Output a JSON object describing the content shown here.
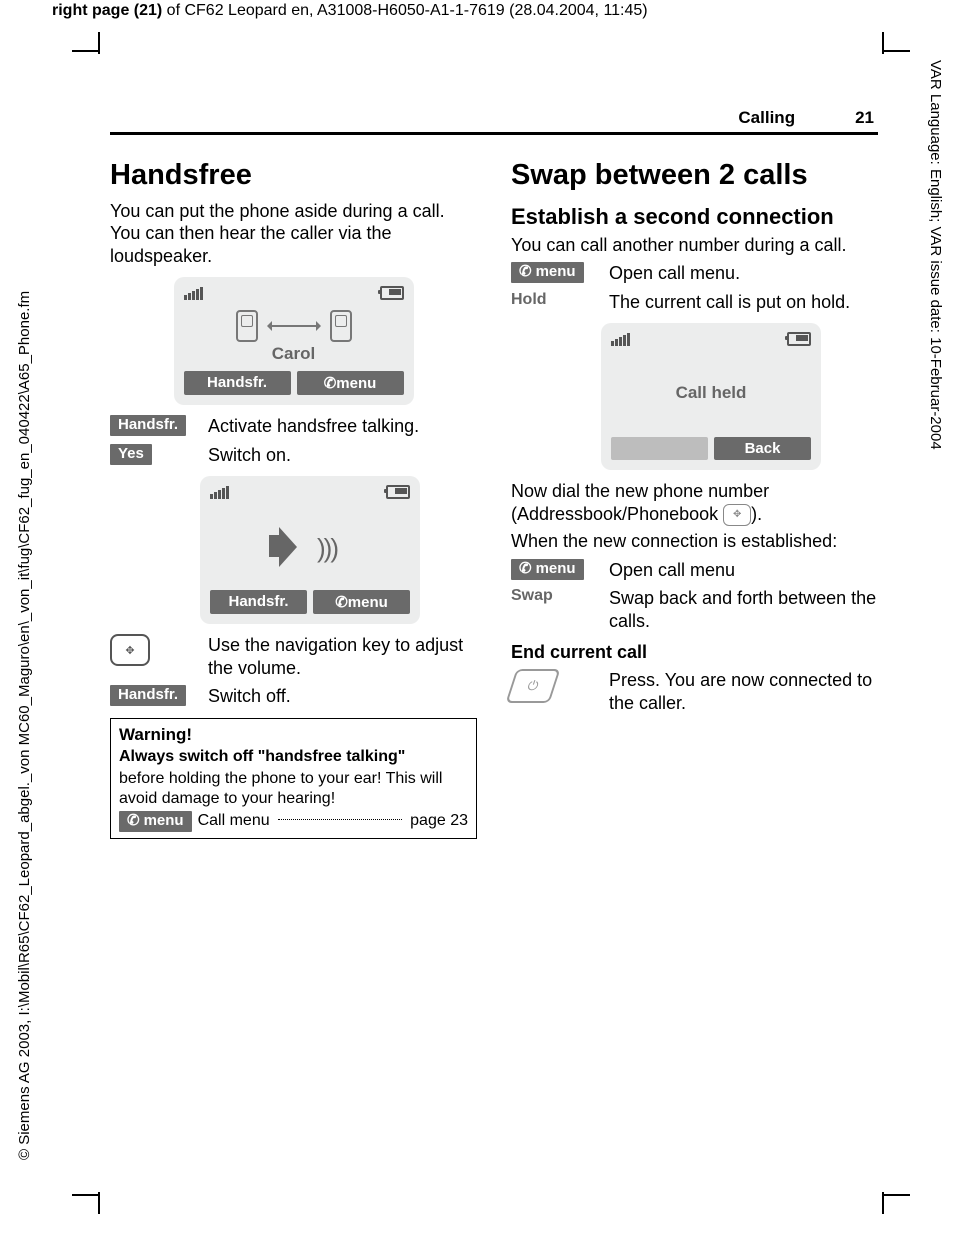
{
  "meta": {
    "top": {
      "prefix": "right page (21)",
      "rest": " of CF62 Leopard en, A31008-H6050-A1-1-7619 (28.04.2004, 11:45)"
    },
    "left": "© Siemens AG 2003, I:\\Mobil\\R65\\CF62_Leopard_abgel._von MC60_Maguro\\en\\_von_it\\fug\\CF62_fug_en_040422\\A65_Phone.fm",
    "right": "VAR Language: English; VAR issue date: 10-Februar-2004"
  },
  "runner": {
    "section": "Calling",
    "page": "21"
  },
  "left": {
    "h1": "Handsfree",
    "intro": "You can put the phone aside during a call. You can then hear the caller via the loudspeaker.",
    "screen1": {
      "caller": "Carol",
      "sk_left": "Handsfr.",
      "sk_right": "menu"
    },
    "r1": {
      "key": "Handsfr.",
      "desc": "Activate handsfree talking."
    },
    "r2": {
      "key": "Yes",
      "desc": "Switch on."
    },
    "screen2": {
      "sk_left": "Handsfr.",
      "sk_right": "menu"
    },
    "r3": {
      "desc": "Use the navigation key to adjust the volume."
    },
    "r4": {
      "key": "Handsfr.",
      "desc": "Switch off."
    },
    "warn": {
      "title": "Warning!",
      "l1": "Always switch off \"handsfree talking\"",
      "l2": "before holding the phone to your ear! This will avoid damage to your hearing!",
      "menu": "menu",
      "call": "Call menu",
      "pg": "page 23"
    }
  },
  "right": {
    "h1": "Swap between 2 calls",
    "h2": "Establish a second connection",
    "intro": "You can call another number during a call.",
    "r1": {
      "key": "menu",
      "desc": "Open call menu."
    },
    "r2": {
      "key": "Hold",
      "desc": "The current call is put on hold."
    },
    "screen": {
      "text": "Call held",
      "sk_right": "Back"
    },
    "p2a": "Now dial the new phone number (Addressbook/Phonebook ",
    "p2b": ").",
    "p3": "When the new connection is established:",
    "r3": {
      "key": "menu",
      "desc": "Open call menu"
    },
    "r4": {
      "key": "Swap",
      "desc": "Swap back and forth between the calls."
    },
    "h3": "End current call",
    "r5": {
      "desc": "Press. You are now connected to the caller."
    }
  }
}
